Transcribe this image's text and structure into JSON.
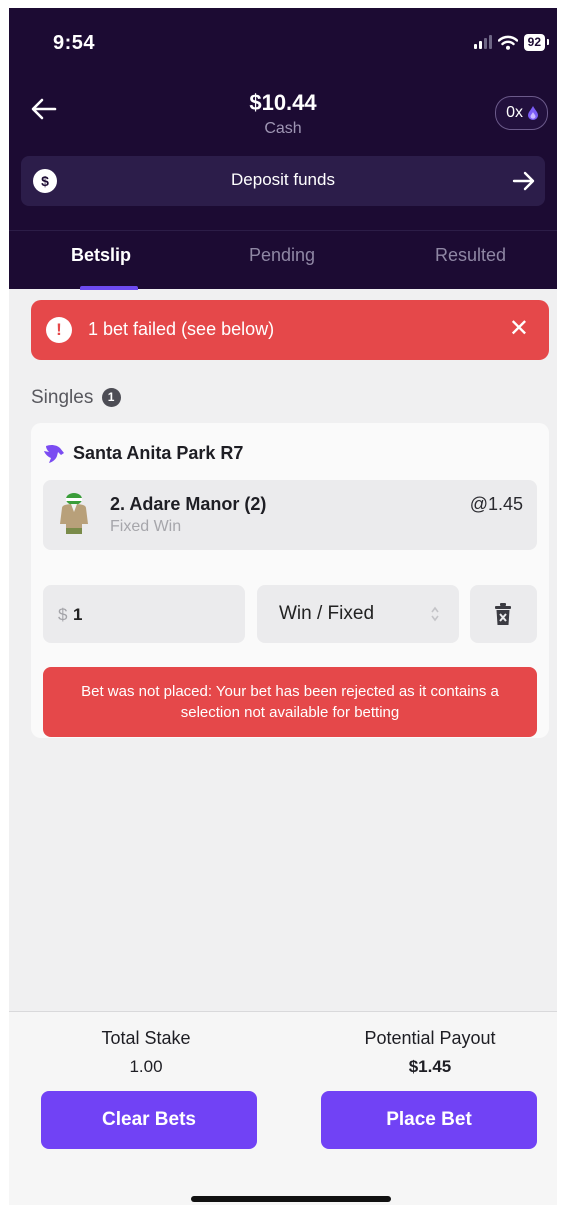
{
  "status_bar": {
    "time": "9:54",
    "battery": "92"
  },
  "header": {
    "balance": "$10.44",
    "balance_label": "Cash",
    "points_pill": "0x",
    "deposit_label": "Deposit funds",
    "deposit_icon_text": "$"
  },
  "tabs": [
    {
      "label": "Betslip",
      "active": true
    },
    {
      "label": "Pending",
      "active": false
    },
    {
      "label": "Resulted",
      "active": false
    }
  ],
  "error_banner": {
    "icon": "!",
    "message": "1 bet failed (see below)",
    "close": "✕"
  },
  "singles": {
    "title": "Singles",
    "count": "1"
  },
  "bet": {
    "race": "Santa Anita Park R7",
    "runner": "2. Adare Manor (2)",
    "bet_kind": "Fixed Win",
    "odds": "@1.45",
    "stake_currency": "$",
    "stake": "1",
    "bet_type": "Win / Fixed",
    "error": "Bet was not placed: Your bet has been rejected as it contains a selection not available for betting"
  },
  "footer": {
    "total_stake_label": "Total Stake",
    "total_stake": "1.00",
    "payout_label": "Potential Payout",
    "payout": "$1.45",
    "clear_label": "Clear Bets",
    "place_label": "Place Bet"
  },
  "colors": {
    "header_bg": "#1c0b33",
    "accent": "#7142f5",
    "error": "#e5484a"
  }
}
